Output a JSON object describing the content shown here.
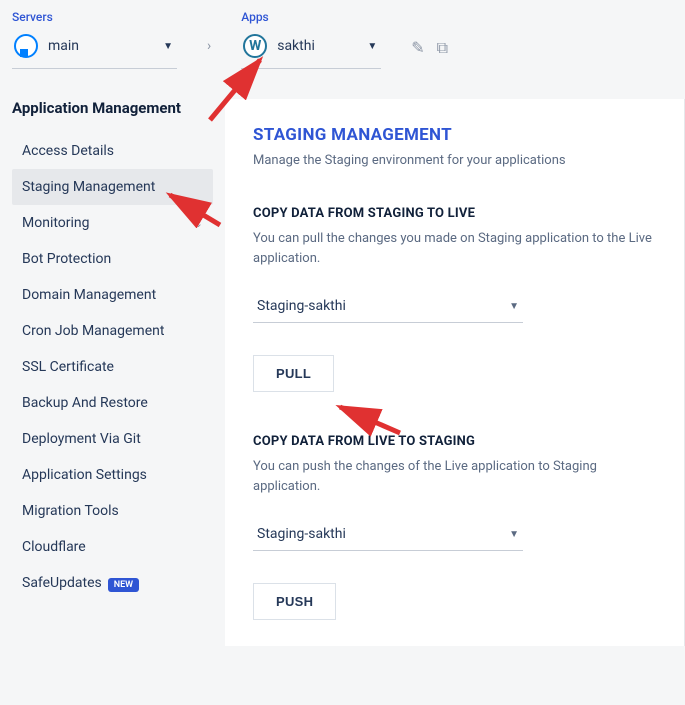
{
  "nav": {
    "servers_label": "Servers",
    "server_name": "main",
    "apps_label": "Apps",
    "app_name": "sakthi"
  },
  "sidebar": {
    "title": "Application Management",
    "items": [
      {
        "label": "Access Details"
      },
      {
        "label": "Staging Management"
      },
      {
        "label": "Monitoring"
      },
      {
        "label": "Bot Protection"
      },
      {
        "label": "Domain Management"
      },
      {
        "label": "Cron Job Management"
      },
      {
        "label": "SSL Certificate"
      },
      {
        "label": "Backup And Restore"
      },
      {
        "label": "Deployment Via Git"
      },
      {
        "label": "Application Settings"
      },
      {
        "label": "Migration Tools"
      },
      {
        "label": "Cloudflare"
      },
      {
        "label": "SafeUpdates"
      }
    ],
    "badge_new": "NEW"
  },
  "main": {
    "title": "STAGING MANAGEMENT",
    "subtitle": "Manage the Staging environment for your applications",
    "pull": {
      "title": "COPY DATA FROM STAGING TO LIVE",
      "desc": "You can pull the changes you made on Staging application to the Live application.",
      "select_value": "Staging-sakthi",
      "button": "PULL"
    },
    "push": {
      "title": "COPY DATA FROM LIVE TO STAGING",
      "desc": "You can push the changes of the Live application to Staging application.",
      "select_value": "Staging-sakthi",
      "button": "PUSH"
    }
  }
}
